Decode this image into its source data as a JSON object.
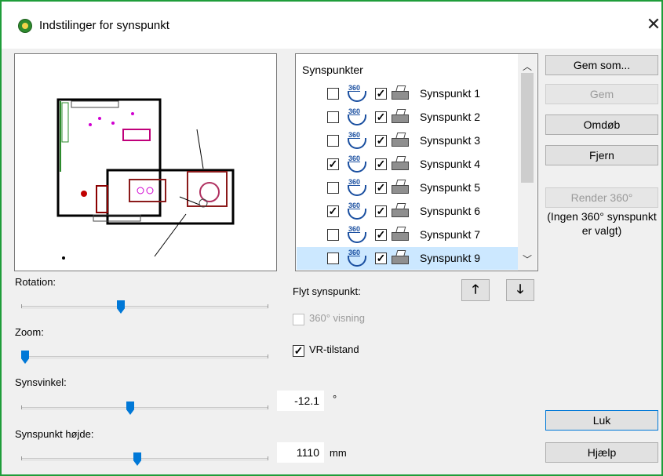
{
  "window": {
    "title": "Indstilinger for synspunkt",
    "close_glyph": "✕"
  },
  "sliders": {
    "rotation_label": "Rotation:",
    "rotation_value": 0.4,
    "zoom_label": "Zoom:",
    "zoom_value": 0.0,
    "angle_label": "Synsvinkel:",
    "angle_value": "-12.1",
    "angle_unit": "°",
    "angle_position": 0.44,
    "height_label": "Synspunkt højde:",
    "height_value": "1110",
    "height_unit": "mm",
    "height_position": 0.47
  },
  "list": {
    "header": "Synspunkter",
    "icon360_text": "360",
    "items": [
      {
        "label": "Synspunkt 1",
        "check360": false,
        "check_show": true
      },
      {
        "label": "Synspunkt 2",
        "check360": false,
        "check_show": true
      },
      {
        "label": "Synspunkt 3",
        "check360": false,
        "check_show": true
      },
      {
        "label": "Synspunkt 4",
        "check360": true,
        "check_show": true
      },
      {
        "label": "Synspunkt 5",
        "check360": false,
        "check_show": true
      },
      {
        "label": "Synspunkt 6",
        "check360": true,
        "check_show": true
      },
      {
        "label": "Synspunkt 7",
        "check360": false,
        "check_show": true
      },
      {
        "label": "Synspunkt 9",
        "check360": false,
        "check_show": true,
        "selected": true
      }
    ]
  },
  "move": {
    "label": "Flyt synspunkt:",
    "up": "🡑",
    "down": "🡓"
  },
  "options": {
    "view360_label": "360° visning",
    "view360_checked": false,
    "vr_label": "VR-tilstand",
    "vr_checked": true
  },
  "buttons": {
    "save_as": "Gem som...",
    "save": "Gem",
    "rename": "Omdøb",
    "remove": "Fjern",
    "render360": "Render 360°",
    "note": "(Ingen 360° synspunkt er valgt)",
    "close": "Luk",
    "help": "Hjælp"
  },
  "colors": {
    "accent": "#0078d7",
    "window_border": "#1f9d3a",
    "selection": "#cce8ff"
  }
}
